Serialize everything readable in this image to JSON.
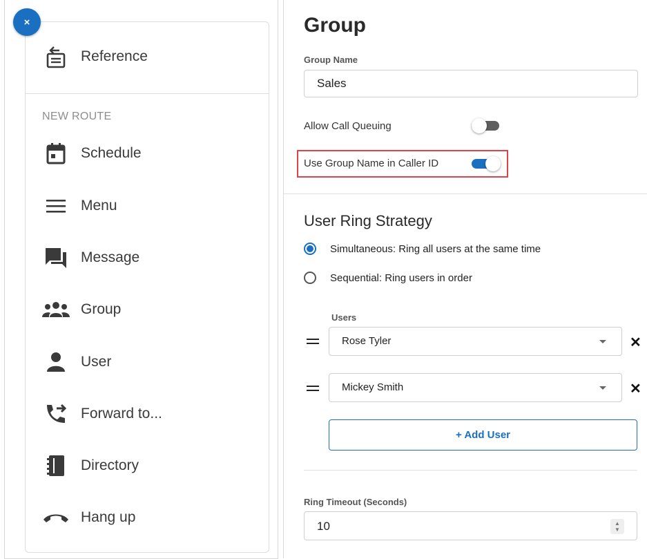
{
  "sidebar": {
    "close_icon": "×",
    "reference": {
      "label": "Reference",
      "icon": "reference-icon"
    },
    "section_label": "NEW ROUTE",
    "items": [
      {
        "label": "Schedule",
        "icon": "calendar-icon"
      },
      {
        "label": "Menu",
        "icon": "menu-lines-icon"
      },
      {
        "label": "Message",
        "icon": "chat-bubbles-icon"
      },
      {
        "label": "Group",
        "icon": "group-icon"
      },
      {
        "label": "User",
        "icon": "person-icon"
      },
      {
        "label": "Forward to...",
        "icon": "phone-forward-icon"
      },
      {
        "label": "Directory",
        "icon": "directory-book-icon"
      },
      {
        "label": "Hang up",
        "icon": "hang-up-icon"
      }
    ]
  },
  "panel": {
    "title": "Group",
    "group_name_label": "Group Name",
    "group_name_value": "Sales",
    "allow_call_queuing_label": "Allow Call Queuing",
    "allow_call_queuing_on": false,
    "use_group_name_label": "Use Group Name in Caller ID",
    "use_group_name_on": true,
    "ring_strategy_title": "User Ring Strategy",
    "strategies": [
      {
        "label": "Simultaneous: Ring all users at the same time",
        "selected": true
      },
      {
        "label": "Sequential: Ring users in order",
        "selected": false
      }
    ],
    "users_label": "Users",
    "users": [
      "Rose Tyler",
      "Mickey Smith"
    ],
    "remove_icon": "✕",
    "add_user_label": "+ Add User",
    "ring_timeout_label": "Ring Timeout (Seconds)",
    "ring_timeout_value": "10",
    "accent_color": "#1a6fc0",
    "highlight_color": "#e0424a"
  }
}
